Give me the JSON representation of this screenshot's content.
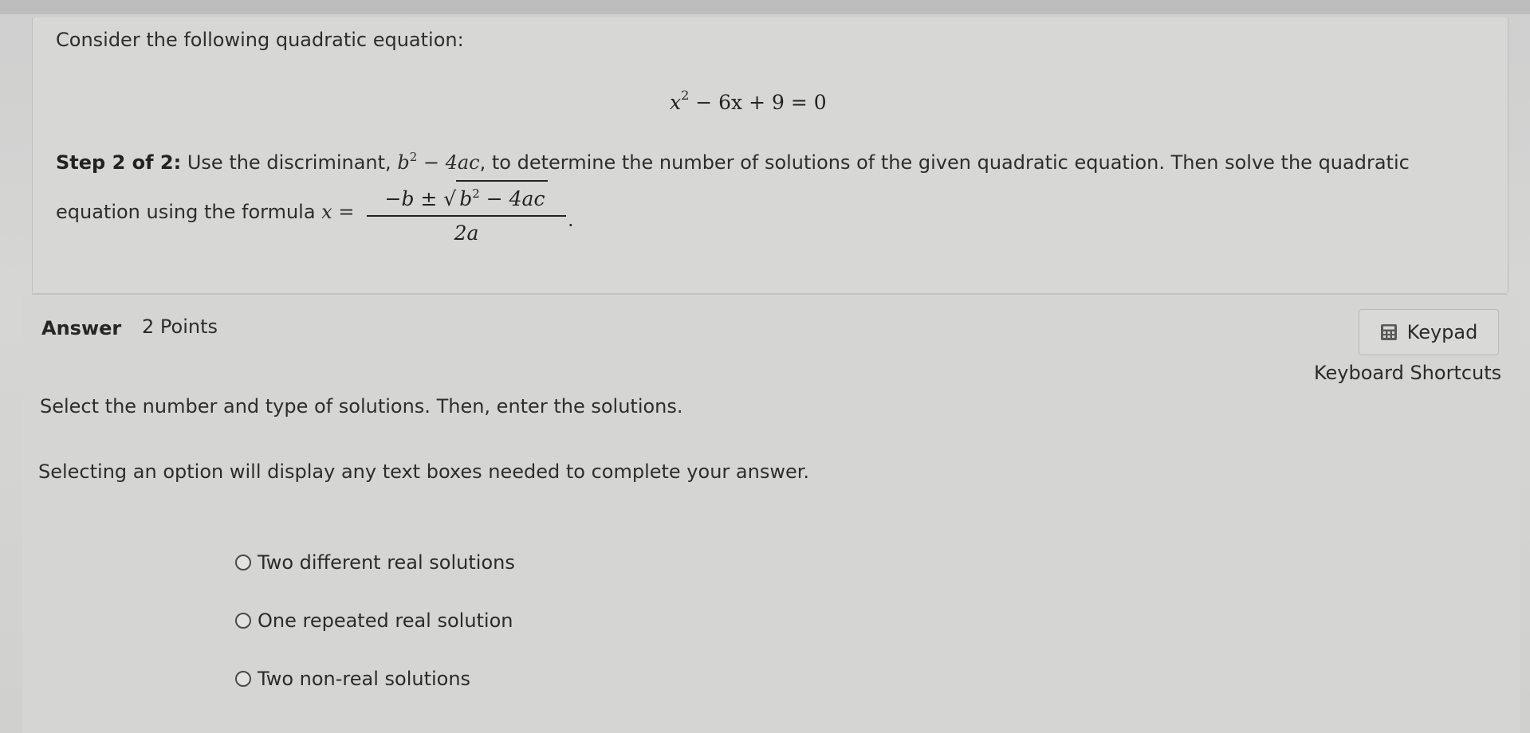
{
  "question": {
    "prompt": "Consider the following quadratic equation:",
    "equation": {
      "x": "x",
      "exp": "2",
      "rest": " − 6x + 9 = 0"
    },
    "step": {
      "label": "Step 2 of 2:",
      "text_before": " Use the discriminant, ",
      "disc_b": "b",
      "disc_exp": "2",
      "disc_rest": " − 4ac",
      "text_after": ", to determine the number of solutions of the given quadratic equation. Then solve the quadratic"
    },
    "formula_line": {
      "text": "equation using the formula ",
      "lhs": "x =",
      "numerator_prefix": "−b ± √",
      "numerator_b": "b",
      "numerator_exp": "2",
      "numerator_rest": " − 4ac",
      "denominator": "2a",
      "period": "."
    }
  },
  "answer": {
    "label": "Answer",
    "points": "2 Points",
    "keypad_label": "Keypad",
    "shortcuts_label": "Keyboard Shortcuts",
    "instruction_1": "Select the number and type of solutions. Then, enter the solutions.",
    "instruction_2": "Selecting an option will display any text boxes needed to complete your answer.",
    "options": [
      {
        "label": "Two different real solutions"
      },
      {
        "label": "One repeated real solution"
      },
      {
        "label": "Two non-real solutions"
      }
    ]
  },
  "icons": {
    "keypad": "calculator-icon",
    "option": "radio-circle-icon"
  }
}
